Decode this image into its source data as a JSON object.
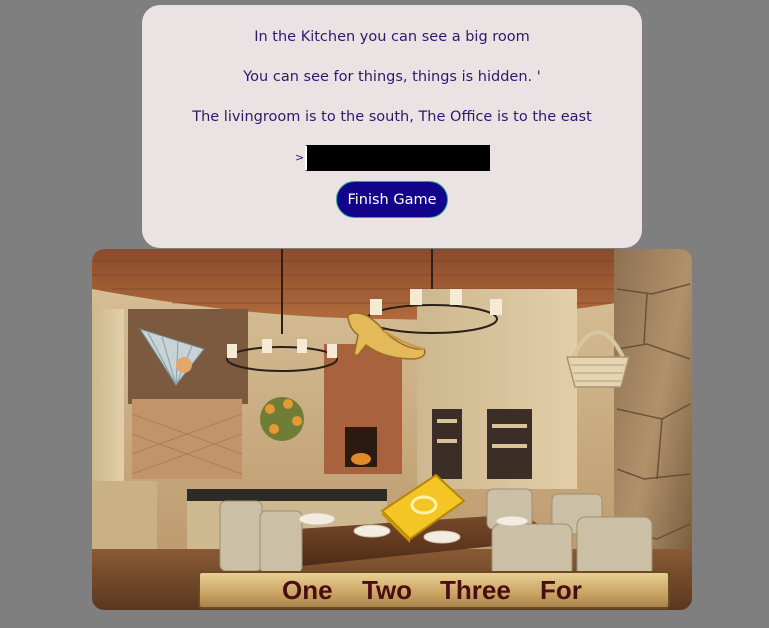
{
  "description": {
    "line1": "In the Kitchen you can see a big room",
    "line2": "You can see for things, things is hidden. '",
    "line3": "The livingroom is to the south, The Office is to the east"
  },
  "command": {
    "prompt": ">",
    "value": ""
  },
  "finish_button": {
    "label": "Finish Game"
  },
  "scene": {
    "room": "Kitchen",
    "hidden_items": [
      "fan",
      "slipper",
      "basket",
      "gold-bar"
    ]
  },
  "inventory": {
    "slots": [
      "One",
      "Two",
      "Three",
      "For"
    ]
  }
}
